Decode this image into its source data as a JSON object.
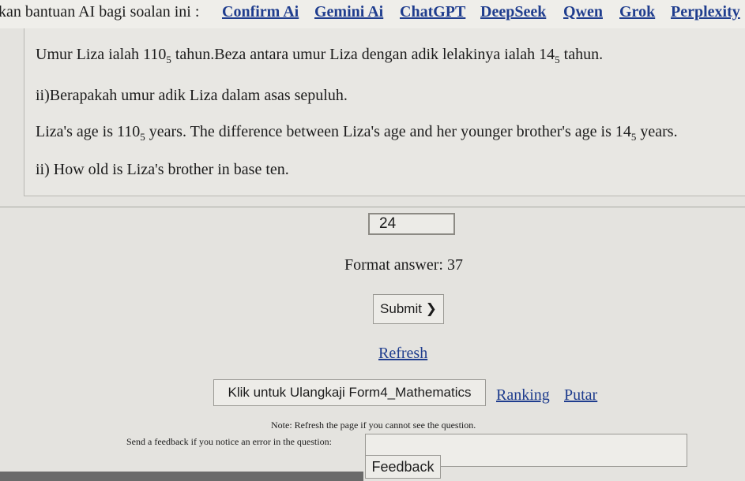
{
  "header": {
    "prefix": "kan bantuan AI bagi soalan ini :",
    "ai_links": [
      "Confirm Ai",
      "Gemini Ai",
      "ChatGPT",
      "DeepSeek",
      "Qwen",
      "Grok",
      "Perplexity"
    ]
  },
  "question": {
    "ms_line1_a": "Umur Liza ialah 110",
    "ms_line1_sub": "5",
    "ms_line1_b": " tahun.Beza antara umur Liza dengan adik lelakinya ialah 14",
    "ms_line1_sub2": "5",
    "ms_line1_c": " tahun.",
    "ms_line2": "ii)Berapakah umur adik Liza dalam asas sepuluh.",
    "en_line1_a": "Liza's age is 110",
    "en_line1_sub": "5",
    "en_line1_b": " years. The difference between Liza's age and her younger brother's age is 14",
    "en_line1_sub2": "5",
    "en_line1_c": " years.",
    "en_line2": "ii) How old is Liza's brother in base ten."
  },
  "answer": {
    "value": "24"
  },
  "format_text": "Format answer: 37",
  "buttons": {
    "submit": "Submit ❯",
    "refresh": "Refresh",
    "klik": "Klik untuk Ulangkaji Form4_Mathematics",
    "ranking": "Ranking",
    "putar": "Putar",
    "feedback": "Feedback"
  },
  "note": "Note: Refresh the page if you cannot see the question.",
  "feedback_label": "Send a feedback if you notice an error in the question:"
}
